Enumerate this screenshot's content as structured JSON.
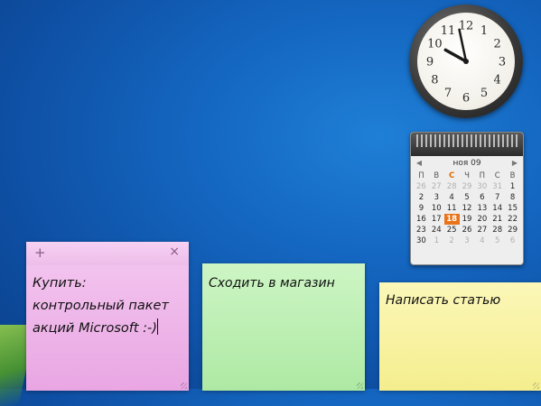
{
  "calendar": {
    "month_label": "ноя 09",
    "weekdays": [
      "П",
      "В",
      "С",
      "Ч",
      "П",
      "С",
      "В"
    ],
    "weeks": [
      [
        26,
        27,
        28,
        29,
        30,
        31,
        1
      ],
      [
        2,
        3,
        4,
        5,
        6,
        7,
        8
      ],
      [
        9,
        10,
        11,
        12,
        13,
        14,
        15
      ],
      [
        16,
        17,
        18,
        19,
        20,
        21,
        22
      ],
      [
        23,
        24,
        25,
        26,
        27,
        28,
        29
      ],
      [
        30,
        1,
        2,
        3,
        4,
        5,
        6
      ]
    ],
    "today": 18,
    "today_color": "#e8731a"
  },
  "clock": {
    "hour": 9,
    "minute": 58,
    "numerals": [
      "12",
      "1",
      "2",
      "3",
      "4",
      "5",
      "6",
      "7",
      "8",
      "9",
      "10",
      "11"
    ]
  },
  "notes": [
    {
      "color": "#eeb7ea",
      "lines": [
        "Купить:",
        "контрольный пакет",
        "акций Microsoft :-)"
      ]
    },
    {
      "color": "#c0f0b5",
      "text": "Сходить в магазин"
    },
    {
      "color": "#f8f1a2",
      "text": "Написать статью"
    }
  ],
  "note_controls": {
    "add": "+",
    "close": "×"
  },
  "icons": {
    "prev": "◀",
    "next": "▶"
  }
}
